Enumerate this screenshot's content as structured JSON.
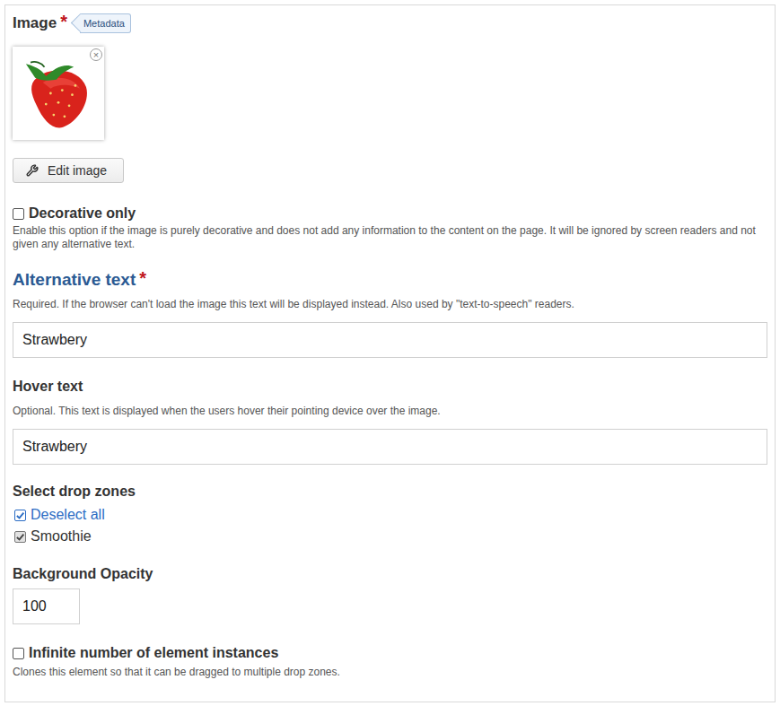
{
  "image_field": {
    "label": "Image",
    "required": true,
    "required_mark": "*",
    "metadata_badge": "Metadata",
    "remove_button": "×",
    "edit_button": "Edit image"
  },
  "decorative": {
    "label": "Decorative only",
    "checked": false,
    "description": "Enable this option if the image is purely decorative and does not add any information to the content on the page. It will be ignored by screen readers and not given any alternative text."
  },
  "text_fields": [
    {
      "label": "Alternative text",
      "required": true,
      "required_mark": "*",
      "focused": true,
      "description": "Required. If the browser can't load the image this text will be displayed instead. Also used by \"text-to-speech\" readers.",
      "value": "Strawbery"
    },
    {
      "label": "Hover text",
      "required": false,
      "required_mark": "",
      "focused": false,
      "description": "Optional. This text is displayed when the users hover their pointing device over the image.",
      "value": "Strawbery"
    }
  ],
  "drop_zones": {
    "label": "Select drop zones",
    "toggle_all": {
      "label": "Deselect all",
      "checked": true
    },
    "items": [
      {
        "label": "Smoothie",
        "checked": true
      }
    ]
  },
  "opacity": {
    "label": "Background Opacity",
    "value": "100"
  },
  "infinite": {
    "label": "Infinite number of element instances",
    "checked": false,
    "description": "Clones this element so that it can be dragged to multiple drop zones."
  }
}
